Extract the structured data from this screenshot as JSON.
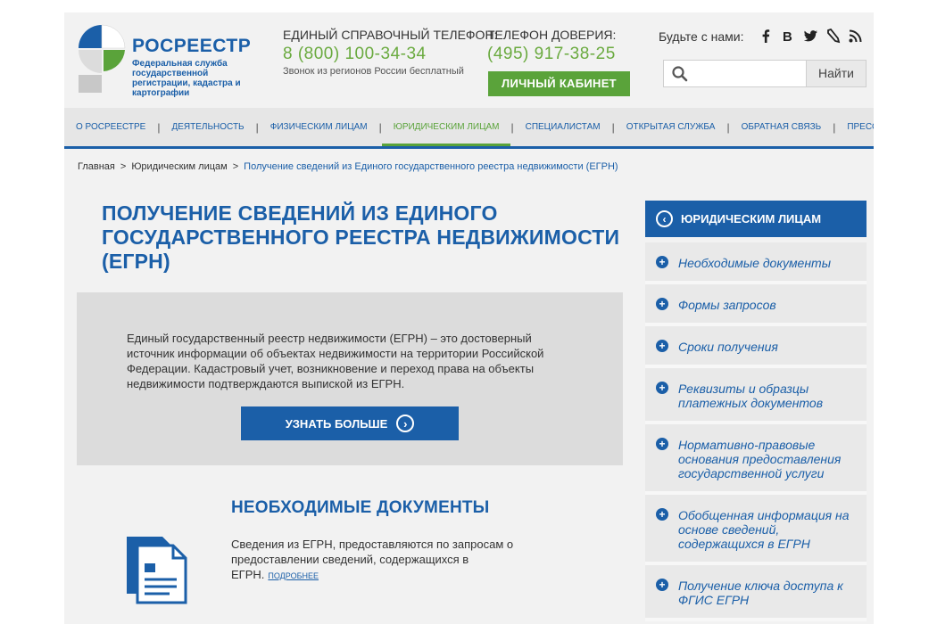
{
  "header": {
    "logo_title": "РОСРЕЕСТР",
    "logo_subtitle": "Федеральная служба государственной регистрации, кадастра и картографии",
    "hotline": {
      "label": "ЕДИНЫЙ СПРАВОЧНЫЙ ТЕЛЕФОН:",
      "number": "8 (800) 100-34-34",
      "note": "Звонок из регионов России бесплатный"
    },
    "trust_line": {
      "label": "ТЕЛЕФОН ДОВЕРИЯ:",
      "number": "(495) 917-38-25"
    },
    "cabinet_button": "ЛИЧНЫЙ КАБИНЕТ",
    "social_label": "Будьте с нами:",
    "social_icons": [
      "facebook-icon",
      "vk-icon",
      "twitter-icon",
      "lj-icon",
      "rss-icon"
    ],
    "search": {
      "placeholder": "",
      "button": "Найти"
    }
  },
  "nav": {
    "items": [
      {
        "label": "О РОСРЕЕСТРЕ",
        "active": false
      },
      {
        "label": "ДЕЯТЕЛЬНОСТЬ",
        "active": false
      },
      {
        "label": "ФИЗИЧЕСКИМ ЛИЦАМ",
        "active": false
      },
      {
        "label": "ЮРИДИЧЕСКИМ ЛИЦАМ",
        "active": true
      },
      {
        "label": "СПЕЦИАЛИСТАМ",
        "active": false
      },
      {
        "label": "ОТКРЫТАЯ СЛУЖБА",
        "active": false
      },
      {
        "label": "ОБРАТНАЯ СВЯЗЬ",
        "active": false
      },
      {
        "label": "ПРЕСС-ЦЕНТР",
        "active": false
      }
    ]
  },
  "breadcrumb": {
    "home": "Главная",
    "section": "Юридическим лицам",
    "current": "Получение сведений из Единого государственного реестра недвижимости (ЕГРН)",
    "separator": ">"
  },
  "main": {
    "title": "ПОЛУЧЕНИЕ СВЕДЕНИЙ ИЗ ЕДИНОГО ГОСУДАРСТВЕННОГО РЕЕСТРА НЕДВИЖИМОСТИ (ЕГРН)",
    "intro": "Единый государственный реестр недвижимости (ЕГРН) – это достоверный источник информации об объектах недвижимости на территории Российской Федерации. Кадастровый учет, возникновение и переход права на объекты недвижимости подтверждаются выпиской из ЕГРН.",
    "more_button": "УЗНАТЬ БОЛЬШЕ",
    "section_title": "НЕОБХОДИМЫЕ ДОКУМЕНТЫ",
    "section_text": "Сведения из ЕГРН, предоставляются по запросам о предоставлении сведений, содержащихся в ЕГРН.",
    "section_link": "ПОДРОБНЕЕ"
  },
  "sidebar": {
    "header": "ЮРИДИЧЕСКИМ ЛИЦАМ",
    "items": [
      {
        "label": "Необходимые документы"
      },
      {
        "label": "Формы запросов"
      },
      {
        "label": "Сроки получения"
      },
      {
        "label": "Реквизиты и образцы платежных документов"
      },
      {
        "label": "Нормативно-правовые основания предоставления государственной услуги"
      },
      {
        "label": "Обобщенная информация на основе сведений, содержащихся в ЕГРН"
      },
      {
        "label": "Получение ключа доступа к ФГИС ЕГРН"
      }
    ]
  },
  "colors": {
    "brand_blue": "#1b5fa8",
    "brand_green": "#5aa33a",
    "phone_green": "#6aaa3f"
  }
}
